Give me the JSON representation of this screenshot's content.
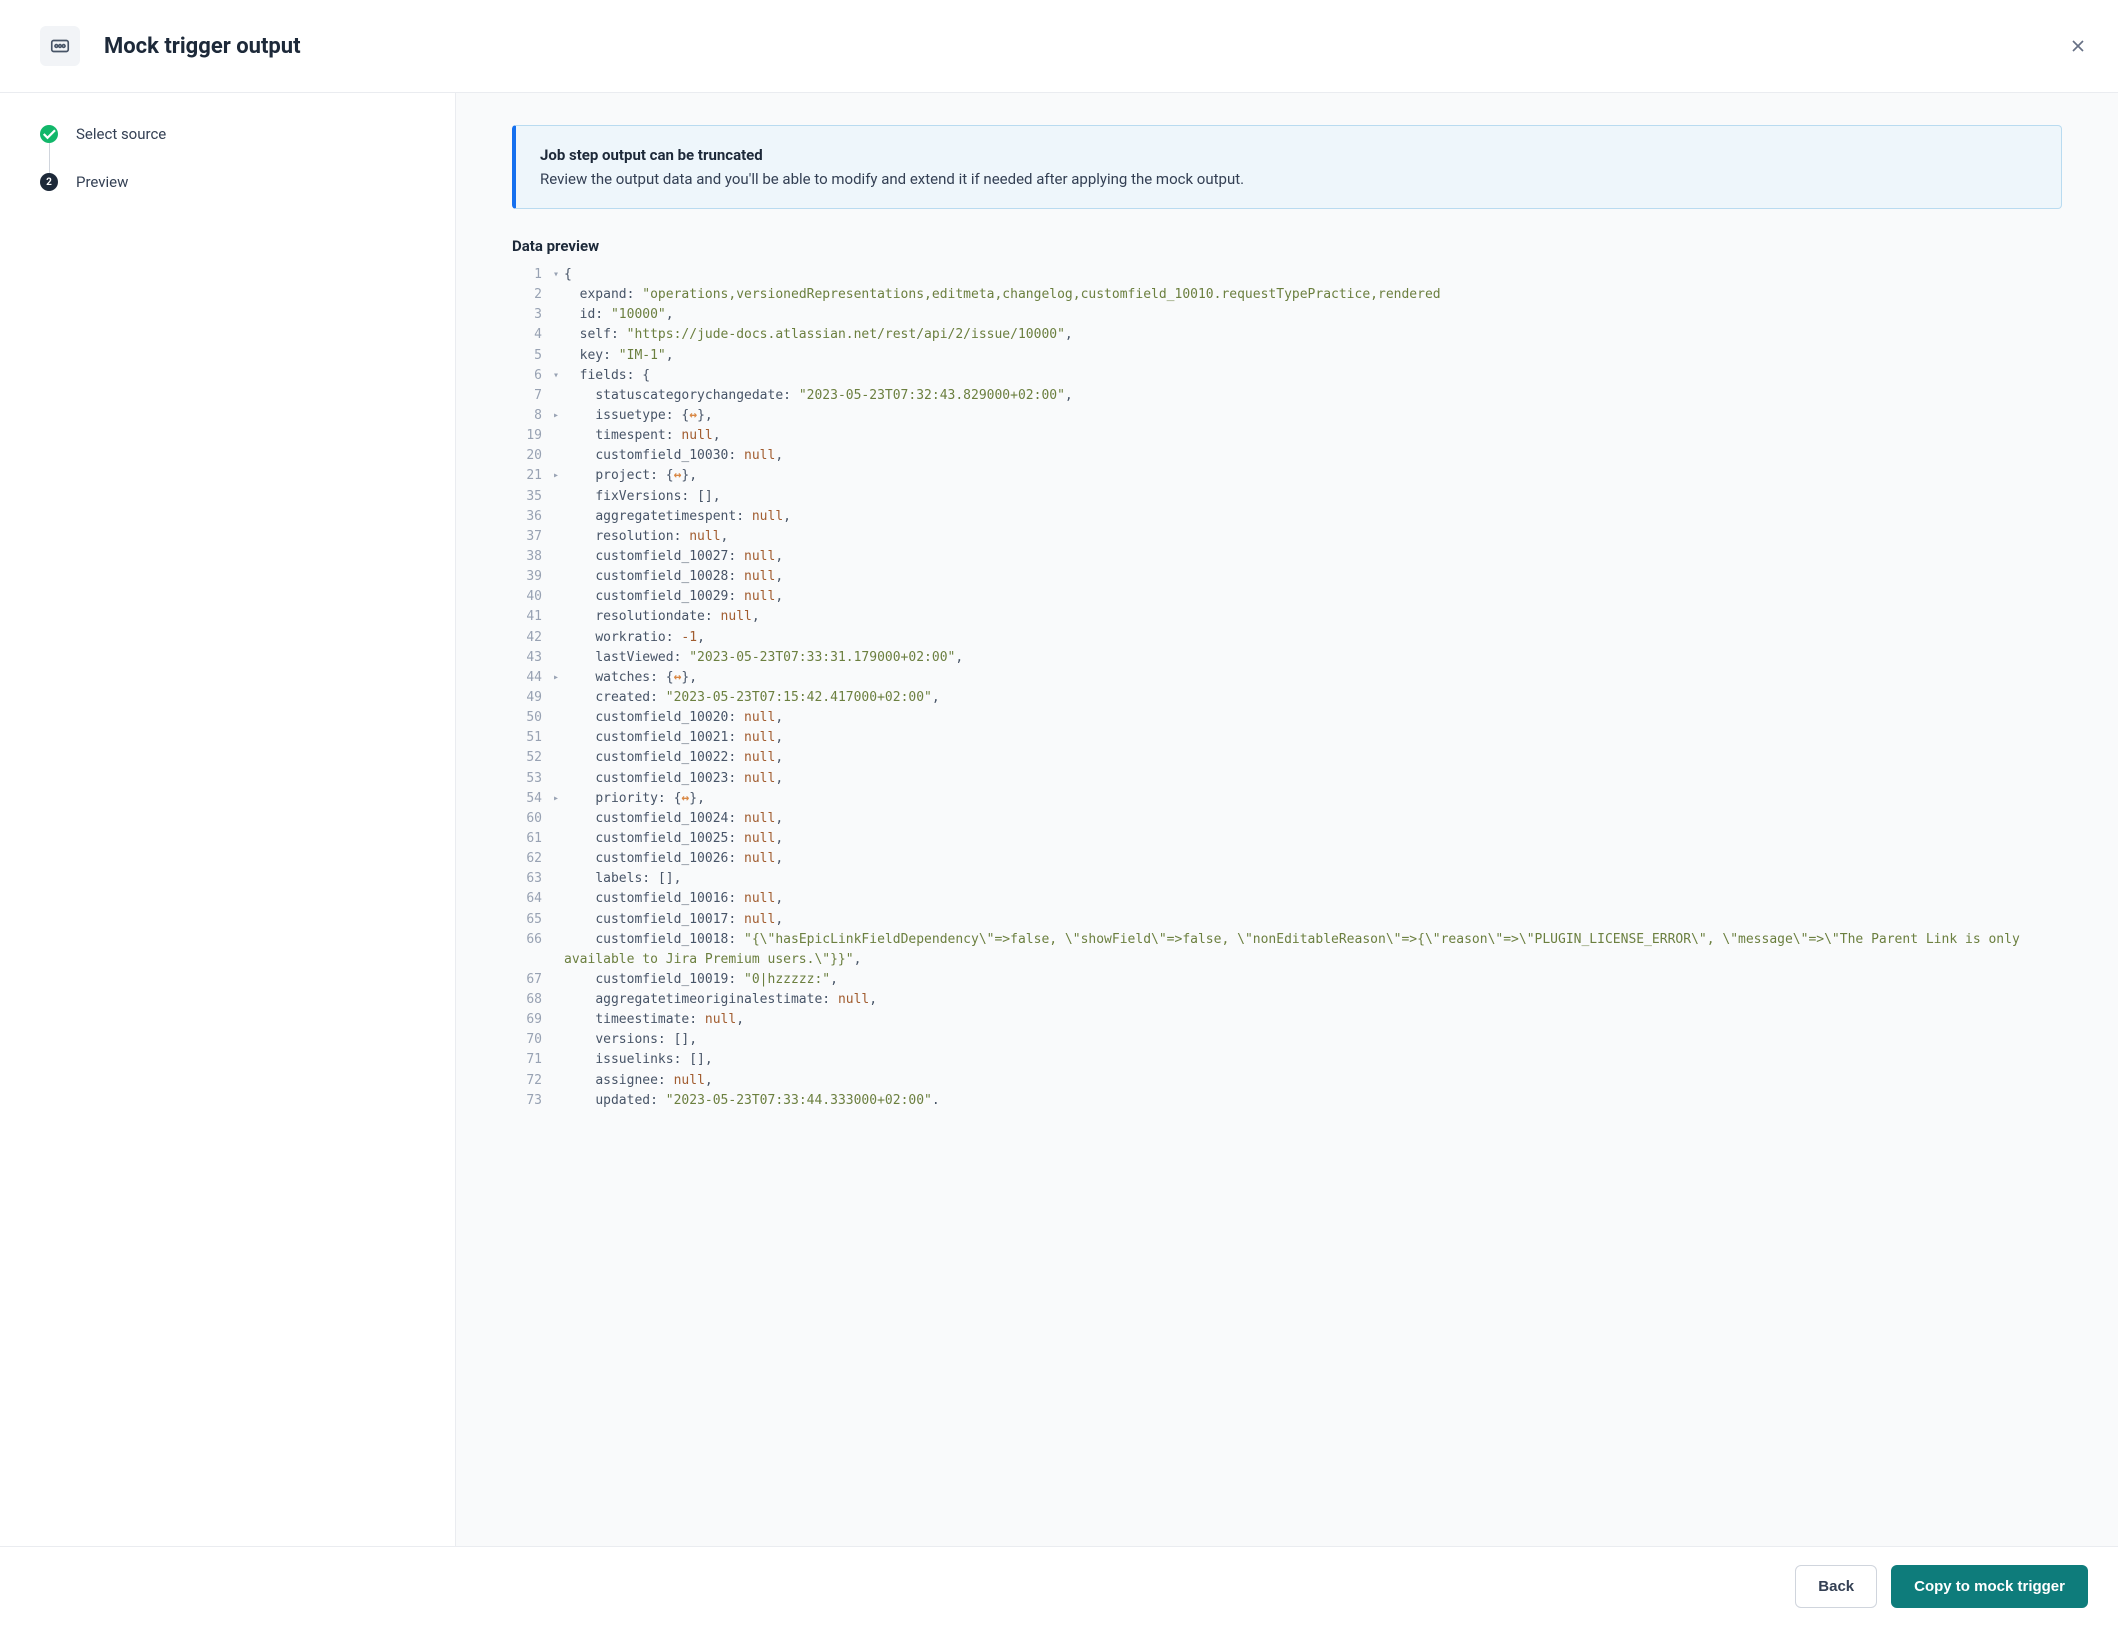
{
  "header": {
    "title": "Mock trigger output"
  },
  "steps": [
    {
      "label": "Select source",
      "state": "done"
    },
    {
      "label": "Preview",
      "state": "current",
      "num": "2"
    }
  ],
  "notice": {
    "title": "Job step output can be truncated",
    "body": "Review the output data and you'll be able to modify and extend it if needed after applying the mock output."
  },
  "section_heading": "Data preview",
  "footer": {
    "back": "Back",
    "apply": "Copy to mock trigger"
  },
  "code": [
    {
      "ln": "1",
      "fold": "▾",
      "indent": 0,
      "tokens": [
        [
          "p",
          "{"
        ]
      ]
    },
    {
      "ln": "2",
      "fold": "",
      "indent": 1,
      "tokens": [
        [
          "k",
          "expand:"
        ],
        [
          "sp",
          " "
        ],
        [
          "s",
          "\"operations,versionedRepresentations,editmeta,changelog,customfield_10010.requestTypePractice,rendered"
        ]
      ]
    },
    {
      "ln": "3",
      "fold": "",
      "indent": 1,
      "tokens": [
        [
          "k",
          "id:"
        ],
        [
          "sp",
          " "
        ],
        [
          "s",
          "\"10000\""
        ],
        [
          "p",
          ","
        ]
      ]
    },
    {
      "ln": "4",
      "fold": "",
      "indent": 1,
      "tokens": [
        [
          "k",
          "self:"
        ],
        [
          "sp",
          " "
        ],
        [
          "s",
          "\"https://jude-docs.atlassian.net/rest/api/2/issue/10000\""
        ],
        [
          "p",
          ","
        ]
      ]
    },
    {
      "ln": "5",
      "fold": "",
      "indent": 1,
      "tokens": [
        [
          "k",
          "key:"
        ],
        [
          "sp",
          " "
        ],
        [
          "s",
          "\"IM-1\""
        ],
        [
          "p",
          ","
        ]
      ]
    },
    {
      "ln": "6",
      "fold": "▾",
      "indent": 1,
      "tokens": [
        [
          "k",
          "fields:"
        ],
        [
          "sp",
          " "
        ],
        [
          "p",
          "{"
        ]
      ]
    },
    {
      "ln": "7",
      "fold": "",
      "indent": 2,
      "tokens": [
        [
          "k",
          "statuscategorychangedate:"
        ],
        [
          "sp",
          " "
        ],
        [
          "s",
          "\"2023-05-23T07:32:43.829000+02:00\""
        ],
        [
          "p",
          ","
        ]
      ]
    },
    {
      "ln": "8",
      "fold": "▸",
      "indent": 2,
      "tokens": [
        [
          "k",
          "issuetype:"
        ],
        [
          "sp",
          " "
        ],
        [
          "p",
          "{"
        ],
        [
          "coll",
          "↔"
        ],
        [
          "p",
          "},"
        ]
      ]
    },
    {
      "ln": "19",
      "fold": "",
      "indent": 2,
      "tokens": [
        [
          "k",
          "timespent:"
        ],
        [
          "sp",
          " "
        ],
        [
          "nl",
          "null"
        ],
        [
          "p",
          ","
        ]
      ]
    },
    {
      "ln": "20",
      "fold": "",
      "indent": 2,
      "tokens": [
        [
          "k",
          "customfield_10030:"
        ],
        [
          "sp",
          " "
        ],
        [
          "nl",
          "null"
        ],
        [
          "p",
          ","
        ]
      ]
    },
    {
      "ln": "21",
      "fold": "▸",
      "indent": 2,
      "tokens": [
        [
          "k",
          "project:"
        ],
        [
          "sp",
          " "
        ],
        [
          "p",
          "{"
        ],
        [
          "coll",
          "↔"
        ],
        [
          "p",
          "},"
        ]
      ]
    },
    {
      "ln": "35",
      "fold": "",
      "indent": 2,
      "tokens": [
        [
          "k",
          "fixVersions:"
        ],
        [
          "sp",
          " "
        ],
        [
          "p",
          "[],"
        ]
      ]
    },
    {
      "ln": "36",
      "fold": "",
      "indent": 2,
      "tokens": [
        [
          "k",
          "aggregatetimespent:"
        ],
        [
          "sp",
          " "
        ],
        [
          "nl",
          "null"
        ],
        [
          "p",
          ","
        ]
      ]
    },
    {
      "ln": "37",
      "fold": "",
      "indent": 2,
      "tokens": [
        [
          "k",
          "resolution:"
        ],
        [
          "sp",
          " "
        ],
        [
          "nl",
          "null"
        ],
        [
          "p",
          ","
        ]
      ]
    },
    {
      "ln": "38",
      "fold": "",
      "indent": 2,
      "tokens": [
        [
          "k",
          "customfield_10027:"
        ],
        [
          "sp",
          " "
        ],
        [
          "nl",
          "null"
        ],
        [
          "p",
          ","
        ]
      ]
    },
    {
      "ln": "39",
      "fold": "",
      "indent": 2,
      "tokens": [
        [
          "k",
          "customfield_10028:"
        ],
        [
          "sp",
          " "
        ],
        [
          "nl",
          "null"
        ],
        [
          "p",
          ","
        ]
      ]
    },
    {
      "ln": "40",
      "fold": "",
      "indent": 2,
      "tokens": [
        [
          "k",
          "customfield_10029:"
        ],
        [
          "sp",
          " "
        ],
        [
          "nl",
          "null"
        ],
        [
          "p",
          ","
        ]
      ]
    },
    {
      "ln": "41",
      "fold": "",
      "indent": 2,
      "tokens": [
        [
          "k",
          "resolutiondate:"
        ],
        [
          "sp",
          " "
        ],
        [
          "nl",
          "null"
        ],
        [
          "p",
          ","
        ]
      ]
    },
    {
      "ln": "42",
      "fold": "",
      "indent": 2,
      "tokens": [
        [
          "k",
          "workratio:"
        ],
        [
          "sp",
          " "
        ],
        [
          "n",
          "-1"
        ],
        [
          "p",
          ","
        ]
      ]
    },
    {
      "ln": "43",
      "fold": "",
      "indent": 2,
      "tokens": [
        [
          "k",
          "lastViewed:"
        ],
        [
          "sp",
          " "
        ],
        [
          "s",
          "\"2023-05-23T07:33:31.179000+02:00\""
        ],
        [
          "p",
          ","
        ]
      ]
    },
    {
      "ln": "44",
      "fold": "▸",
      "indent": 2,
      "tokens": [
        [
          "k",
          "watches:"
        ],
        [
          "sp",
          " "
        ],
        [
          "p",
          "{"
        ],
        [
          "coll",
          "↔"
        ],
        [
          "p",
          "},"
        ]
      ]
    },
    {
      "ln": "49",
      "fold": "",
      "indent": 2,
      "tokens": [
        [
          "k",
          "created:"
        ],
        [
          "sp",
          " "
        ],
        [
          "s",
          "\"2023-05-23T07:15:42.417000+02:00\""
        ],
        [
          "p",
          ","
        ]
      ]
    },
    {
      "ln": "50",
      "fold": "",
      "indent": 2,
      "tokens": [
        [
          "k",
          "customfield_10020:"
        ],
        [
          "sp",
          " "
        ],
        [
          "nl",
          "null"
        ],
        [
          "p",
          ","
        ]
      ]
    },
    {
      "ln": "51",
      "fold": "",
      "indent": 2,
      "tokens": [
        [
          "k",
          "customfield_10021:"
        ],
        [
          "sp",
          " "
        ],
        [
          "nl",
          "null"
        ],
        [
          "p",
          ","
        ]
      ]
    },
    {
      "ln": "52",
      "fold": "",
      "indent": 2,
      "tokens": [
        [
          "k",
          "customfield_10022:"
        ],
        [
          "sp",
          " "
        ],
        [
          "nl",
          "null"
        ],
        [
          "p",
          ","
        ]
      ]
    },
    {
      "ln": "53",
      "fold": "",
      "indent": 2,
      "tokens": [
        [
          "k",
          "customfield_10023:"
        ],
        [
          "sp",
          " "
        ],
        [
          "nl",
          "null"
        ],
        [
          "p",
          ","
        ]
      ]
    },
    {
      "ln": "54",
      "fold": "▸",
      "indent": 2,
      "tokens": [
        [
          "k",
          "priority:"
        ],
        [
          "sp",
          " "
        ],
        [
          "p",
          "{"
        ],
        [
          "coll",
          "↔"
        ],
        [
          "p",
          "},"
        ]
      ]
    },
    {
      "ln": "60",
      "fold": "",
      "indent": 2,
      "tokens": [
        [
          "k",
          "customfield_10024:"
        ],
        [
          "sp",
          " "
        ],
        [
          "nl",
          "null"
        ],
        [
          "p",
          ","
        ]
      ]
    },
    {
      "ln": "61",
      "fold": "",
      "indent": 2,
      "tokens": [
        [
          "k",
          "customfield_10025:"
        ],
        [
          "sp",
          " "
        ],
        [
          "nl",
          "null"
        ],
        [
          "p",
          ","
        ]
      ]
    },
    {
      "ln": "62",
      "fold": "",
      "indent": 2,
      "tokens": [
        [
          "k",
          "customfield_10026:"
        ],
        [
          "sp",
          " "
        ],
        [
          "nl",
          "null"
        ],
        [
          "p",
          ","
        ]
      ]
    },
    {
      "ln": "63",
      "fold": "",
      "indent": 2,
      "tokens": [
        [
          "k",
          "labels:"
        ],
        [
          "sp",
          " "
        ],
        [
          "p",
          "[],"
        ]
      ]
    },
    {
      "ln": "64",
      "fold": "",
      "indent": 2,
      "tokens": [
        [
          "k",
          "customfield_10016:"
        ],
        [
          "sp",
          " "
        ],
        [
          "nl",
          "null"
        ],
        [
          "p",
          ","
        ]
      ]
    },
    {
      "ln": "65",
      "fold": "",
      "indent": 2,
      "tokens": [
        [
          "k",
          "customfield_10017:"
        ],
        [
          "sp",
          " "
        ],
        [
          "nl",
          "null"
        ],
        [
          "p",
          ","
        ]
      ]
    },
    {
      "ln": "66",
      "fold": "",
      "indent": 2,
      "tokens": [
        [
          "k",
          "customfield_10018:"
        ],
        [
          "sp",
          " "
        ],
        [
          "s",
          "\"{\\\"hasEpicLinkFieldDependency\\\"=>false, \\\"showField\\\"=>false, \\\"nonEditableReason\\\"=>{\\\"reason\\\"=>\\\"PLUGIN_LICENSE_ERROR\\\", \\\"message\\\"=>\\\"The Parent Link is only available to Jira Premium users.\\\"}}\""
        ],
        [
          "p",
          ","
        ]
      ],
      "wrap": true
    },
    {
      "ln": "67",
      "fold": "",
      "indent": 2,
      "tokens": [
        [
          "k",
          "customfield_10019:"
        ],
        [
          "sp",
          " "
        ],
        [
          "s",
          "\"0|hzzzzz:\""
        ],
        [
          "p",
          ","
        ]
      ]
    },
    {
      "ln": "68",
      "fold": "",
      "indent": 2,
      "tokens": [
        [
          "k",
          "aggregatetimeoriginalestimate:"
        ],
        [
          "sp",
          " "
        ],
        [
          "nl",
          "null"
        ],
        [
          "p",
          ","
        ]
      ]
    },
    {
      "ln": "69",
      "fold": "",
      "indent": 2,
      "tokens": [
        [
          "k",
          "timeestimate:"
        ],
        [
          "sp",
          " "
        ],
        [
          "nl",
          "null"
        ],
        [
          "p",
          ","
        ]
      ]
    },
    {
      "ln": "70",
      "fold": "",
      "indent": 2,
      "tokens": [
        [
          "k",
          "versions:"
        ],
        [
          "sp",
          " "
        ],
        [
          "p",
          "[],"
        ]
      ]
    },
    {
      "ln": "71",
      "fold": "",
      "indent": 2,
      "tokens": [
        [
          "k",
          "issuelinks:"
        ],
        [
          "sp",
          " "
        ],
        [
          "p",
          "[],"
        ]
      ]
    },
    {
      "ln": "72",
      "fold": "",
      "indent": 2,
      "tokens": [
        [
          "k",
          "assignee:"
        ],
        [
          "sp",
          " "
        ],
        [
          "nl",
          "null"
        ],
        [
          "p",
          ","
        ]
      ]
    },
    {
      "ln": "73",
      "fold": "",
      "indent": 2,
      "tokens": [
        [
          "k",
          "updated:"
        ],
        [
          "sp",
          " "
        ],
        [
          "s",
          "\"2023-05-23T07:33:44.333000+02:00\""
        ],
        [
          "p",
          "."
        ]
      ]
    }
  ]
}
